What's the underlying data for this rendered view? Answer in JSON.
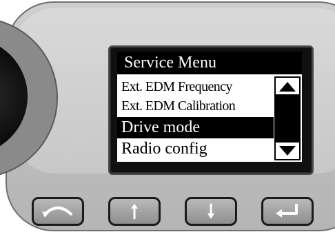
{
  "screen": {
    "title": "Service Menu",
    "menu_items": [
      {
        "label": "Ext. EDM Frequency",
        "selected": false
      },
      {
        "label": "Ext. EDM Calibration",
        "selected": false
      },
      {
        "label": "Drive mode",
        "selected": true
      },
      {
        "label": "Radio config",
        "selected": false
      }
    ],
    "scrollbar": {
      "up_icon": "triangle-up-icon",
      "down_icon": "triangle-down-icon"
    }
  },
  "hardware_buttons": [
    {
      "name": "back-button",
      "icon": "curved-arrow-icon"
    },
    {
      "name": "up-button",
      "icon": "arrow-up-icon"
    },
    {
      "name": "down-button",
      "icon": "arrow-down-icon"
    },
    {
      "name": "enter-button",
      "icon": "enter-arrow-icon"
    }
  ],
  "colors": {
    "housing": "#c4c4c4",
    "screen_background": "#ffffff",
    "highlight": "#000000",
    "knob": "#000000"
  }
}
